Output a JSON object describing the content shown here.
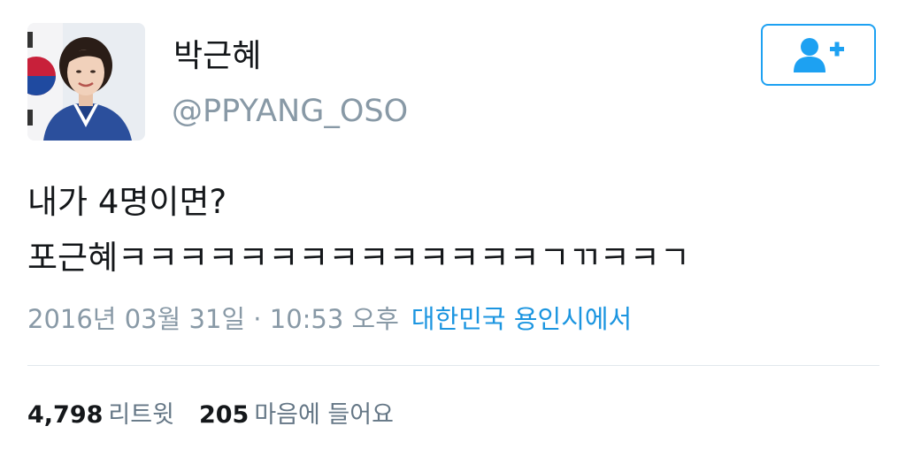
{
  "author": {
    "display_name": "박근혜",
    "handle": "@PPYANG_OSO",
    "avatar": "profile-photo"
  },
  "follow_button": {
    "icon": "add-user-icon",
    "color": "#1da1f2"
  },
  "tweet": {
    "lines": [
      "내가 4명이면?",
      "포근혜ㅋㅋㅋㅋㅋㅋㅋㅋㅋㅋㅋㅋㅋㅋㄱㄲㅋㅋㄱ"
    ]
  },
  "meta": {
    "timestamp": "2016년 03월 31일 · 10:53 오후",
    "location": "대한민국 용인시에서"
  },
  "stats": {
    "retweets_count": "4,798",
    "retweets_label": "리트윗",
    "likes_count": "205",
    "likes_label": "마음에 들어요"
  },
  "colors": {
    "accent": "#1da1f2",
    "link": "#1b95e0",
    "muted": "#8899a6",
    "divider": "#e1e8ed"
  }
}
